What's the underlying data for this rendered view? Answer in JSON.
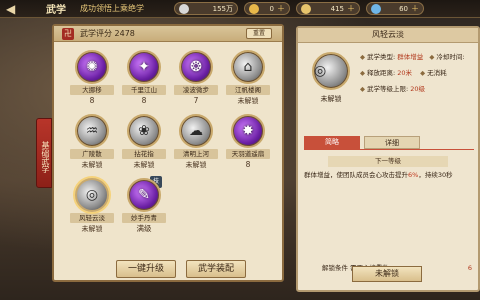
{
  "topbar": {
    "title": "武学",
    "subtitle": "成功领悟上乘绝学",
    "resources": [
      {
        "icon": "silver-coin-icon",
        "value": "155万",
        "color": "#d8d8d8"
      },
      {
        "icon": "gold-ingot-icon",
        "value": "0",
        "color": "#e8b84a"
      },
      {
        "icon": "jade-icon",
        "value": "415",
        "color": "#e7c46c"
      },
      {
        "icon": "gem-icon",
        "value": "60",
        "color": "#6fb6e8"
      }
    ]
  },
  "left": {
    "score_label": "武学评分 2478",
    "reset_label": "重置",
    "side_tab": "基础武学",
    "skills": [
      {
        "name": "大挪移",
        "level": "8",
        "style": "purple",
        "glyph": "✺"
      },
      {
        "name": "千里江山",
        "level": "8",
        "style": "purple",
        "glyph": "✦"
      },
      {
        "name": "凌波微步",
        "level": "7",
        "style": "purple",
        "glyph": "❂"
      },
      {
        "name": "江帆楼阁",
        "level": "未解锁",
        "style": "grey",
        "glyph": "⌂"
      },
      {
        "name": "广陵散",
        "level": "未解锁",
        "style": "grey",
        "glyph": "♒"
      },
      {
        "name": "拈花指",
        "level": "未解锁",
        "style": "grey",
        "glyph": "❀"
      },
      {
        "name": "清明上河",
        "level": "未解锁",
        "style": "grey",
        "glyph": "☁"
      },
      {
        "name": "天羽道遥扇",
        "level": "8",
        "style": "purple",
        "glyph": "✸"
      },
      {
        "name": "风轻云淡",
        "level": "未解锁",
        "style": "grey",
        "glyph": "◎",
        "selected": true
      },
      {
        "name": "妙手丹青",
        "level": "满级",
        "style": "purple",
        "glyph": "✎",
        "badge": "技"
      }
    ],
    "buttons": {
      "upgrade": "一键升级",
      "equip": "武学装配"
    }
  },
  "right": {
    "title": "风轻云淡",
    "locked": "未解锁",
    "attrs": [
      {
        "label": "武学类型:",
        "value": "群体增益",
        "label2": "冷却时间:",
        "value2": ""
      },
      {
        "label": "释放距离:",
        "value": "20米",
        "label2": "无消耗",
        "value2": ""
      },
      {
        "label": "武学等级上限:",
        "value": "20级",
        "label2": "",
        "value2": ""
      }
    ],
    "tabs": {
      "active": "简略",
      "inactive": "详细"
    },
    "next_level": "下一等级",
    "effect_pre": "群体增益，使团队成员会心攻击提升",
    "effect_hl": "6%",
    "effect_post": "，持续30秒",
    "unlock_label": "解锁条件  需要心境重数:",
    "unlock_count": "6",
    "bottom_button": "未解锁"
  }
}
